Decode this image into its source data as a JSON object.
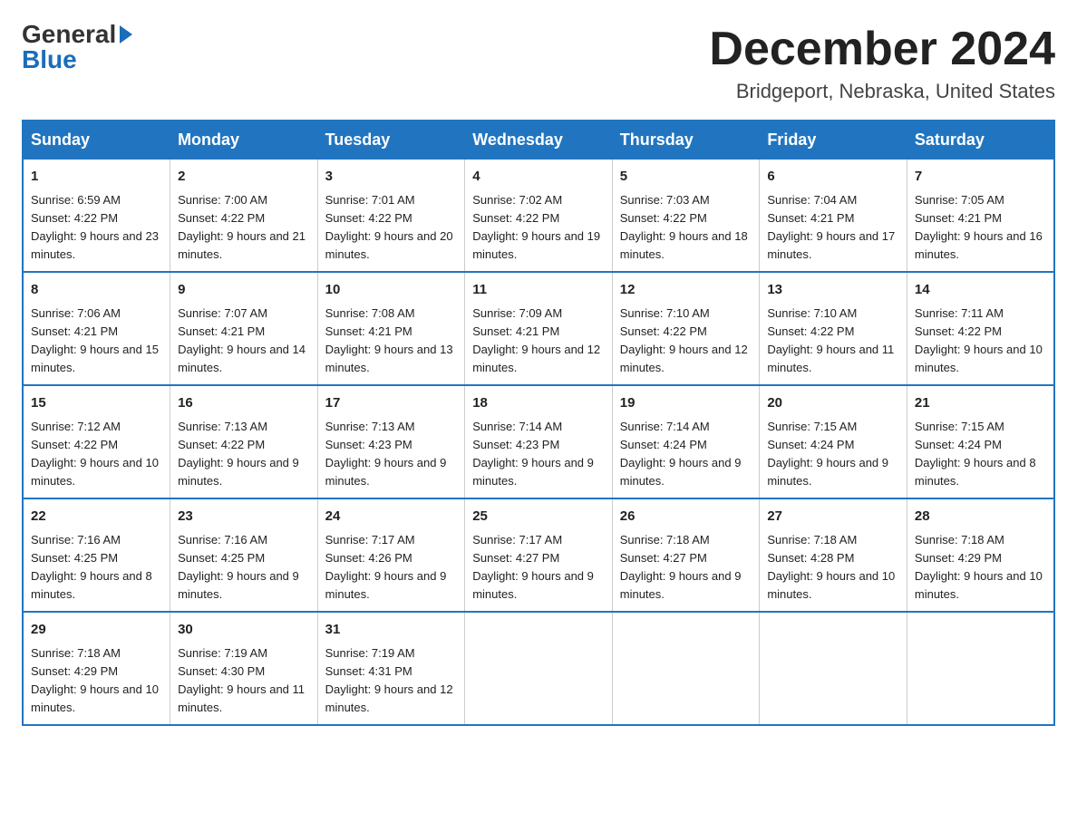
{
  "header": {
    "logo_general": "General",
    "logo_blue": "Blue",
    "title": "December 2024",
    "subtitle": "Bridgeport, Nebraska, United States"
  },
  "days_of_week": [
    "Sunday",
    "Monday",
    "Tuesday",
    "Wednesday",
    "Thursday",
    "Friday",
    "Saturday"
  ],
  "weeks": [
    [
      {
        "day": "1",
        "sunrise": "6:59 AM",
        "sunset": "4:22 PM",
        "daylight": "9 hours and 23 minutes."
      },
      {
        "day": "2",
        "sunrise": "7:00 AM",
        "sunset": "4:22 PM",
        "daylight": "9 hours and 21 minutes."
      },
      {
        "day": "3",
        "sunrise": "7:01 AM",
        "sunset": "4:22 PM",
        "daylight": "9 hours and 20 minutes."
      },
      {
        "day": "4",
        "sunrise": "7:02 AM",
        "sunset": "4:22 PM",
        "daylight": "9 hours and 19 minutes."
      },
      {
        "day": "5",
        "sunrise": "7:03 AM",
        "sunset": "4:22 PM",
        "daylight": "9 hours and 18 minutes."
      },
      {
        "day": "6",
        "sunrise": "7:04 AM",
        "sunset": "4:21 PM",
        "daylight": "9 hours and 17 minutes."
      },
      {
        "day": "7",
        "sunrise": "7:05 AM",
        "sunset": "4:21 PM",
        "daylight": "9 hours and 16 minutes."
      }
    ],
    [
      {
        "day": "8",
        "sunrise": "7:06 AM",
        "sunset": "4:21 PM",
        "daylight": "9 hours and 15 minutes."
      },
      {
        "day": "9",
        "sunrise": "7:07 AM",
        "sunset": "4:21 PM",
        "daylight": "9 hours and 14 minutes."
      },
      {
        "day": "10",
        "sunrise": "7:08 AM",
        "sunset": "4:21 PM",
        "daylight": "9 hours and 13 minutes."
      },
      {
        "day": "11",
        "sunrise": "7:09 AM",
        "sunset": "4:21 PM",
        "daylight": "9 hours and 12 minutes."
      },
      {
        "day": "12",
        "sunrise": "7:10 AM",
        "sunset": "4:22 PM",
        "daylight": "9 hours and 12 minutes."
      },
      {
        "day": "13",
        "sunrise": "7:10 AM",
        "sunset": "4:22 PM",
        "daylight": "9 hours and 11 minutes."
      },
      {
        "day": "14",
        "sunrise": "7:11 AM",
        "sunset": "4:22 PM",
        "daylight": "9 hours and 10 minutes."
      }
    ],
    [
      {
        "day": "15",
        "sunrise": "7:12 AM",
        "sunset": "4:22 PM",
        "daylight": "9 hours and 10 minutes."
      },
      {
        "day": "16",
        "sunrise": "7:13 AM",
        "sunset": "4:22 PM",
        "daylight": "9 hours and 9 minutes."
      },
      {
        "day": "17",
        "sunrise": "7:13 AM",
        "sunset": "4:23 PM",
        "daylight": "9 hours and 9 minutes."
      },
      {
        "day": "18",
        "sunrise": "7:14 AM",
        "sunset": "4:23 PM",
        "daylight": "9 hours and 9 minutes."
      },
      {
        "day": "19",
        "sunrise": "7:14 AM",
        "sunset": "4:24 PM",
        "daylight": "9 hours and 9 minutes."
      },
      {
        "day": "20",
        "sunrise": "7:15 AM",
        "sunset": "4:24 PM",
        "daylight": "9 hours and 9 minutes."
      },
      {
        "day": "21",
        "sunrise": "7:15 AM",
        "sunset": "4:24 PM",
        "daylight": "9 hours and 8 minutes."
      }
    ],
    [
      {
        "day": "22",
        "sunrise": "7:16 AM",
        "sunset": "4:25 PM",
        "daylight": "9 hours and 8 minutes."
      },
      {
        "day": "23",
        "sunrise": "7:16 AM",
        "sunset": "4:25 PM",
        "daylight": "9 hours and 9 minutes."
      },
      {
        "day": "24",
        "sunrise": "7:17 AM",
        "sunset": "4:26 PM",
        "daylight": "9 hours and 9 minutes."
      },
      {
        "day": "25",
        "sunrise": "7:17 AM",
        "sunset": "4:27 PM",
        "daylight": "9 hours and 9 minutes."
      },
      {
        "day": "26",
        "sunrise": "7:18 AM",
        "sunset": "4:27 PM",
        "daylight": "9 hours and 9 minutes."
      },
      {
        "day": "27",
        "sunrise": "7:18 AM",
        "sunset": "4:28 PM",
        "daylight": "9 hours and 10 minutes."
      },
      {
        "day": "28",
        "sunrise": "7:18 AM",
        "sunset": "4:29 PM",
        "daylight": "9 hours and 10 minutes."
      }
    ],
    [
      {
        "day": "29",
        "sunrise": "7:18 AM",
        "sunset": "4:29 PM",
        "daylight": "9 hours and 10 minutes."
      },
      {
        "day": "30",
        "sunrise": "7:19 AM",
        "sunset": "4:30 PM",
        "daylight": "9 hours and 11 minutes."
      },
      {
        "day": "31",
        "sunrise": "7:19 AM",
        "sunset": "4:31 PM",
        "daylight": "9 hours and 12 minutes."
      },
      null,
      null,
      null,
      null
    ]
  ]
}
